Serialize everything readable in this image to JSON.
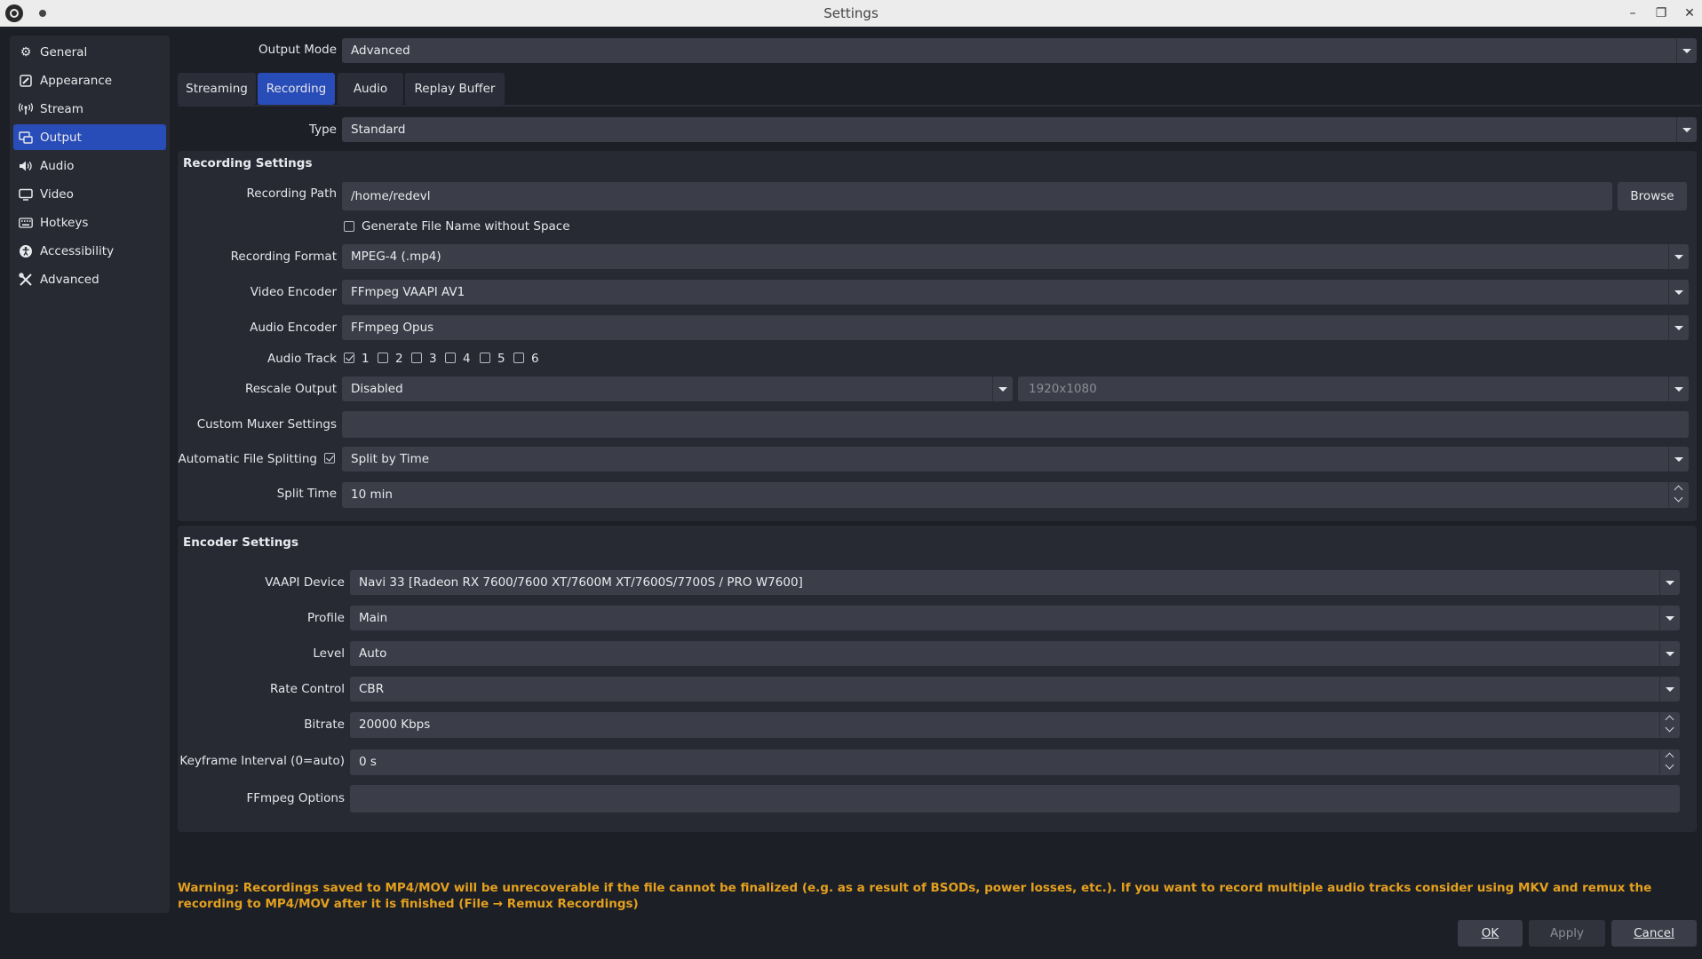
{
  "window": {
    "title": "Settings"
  },
  "sidebar": {
    "items": [
      {
        "label": "General",
        "icon": "gear-icon"
      },
      {
        "label": "Appearance",
        "icon": "appearance-icon"
      },
      {
        "label": "Stream",
        "icon": "antenna-icon"
      },
      {
        "label": "Output",
        "icon": "output-icon",
        "active": true
      },
      {
        "label": "Audio",
        "icon": "speaker-icon"
      },
      {
        "label": "Video",
        "icon": "monitor-icon"
      },
      {
        "label": "Hotkeys",
        "icon": "keyboard-icon"
      },
      {
        "label": "Accessibility",
        "icon": "accessibility-icon"
      },
      {
        "label": "Advanced",
        "icon": "tools-icon"
      }
    ]
  },
  "output_mode": {
    "label": "Output Mode",
    "value": "Advanced"
  },
  "tabs": [
    {
      "label": "Streaming"
    },
    {
      "label": "Recording",
      "active": true
    },
    {
      "label": "Audio"
    },
    {
      "label": "Replay Buffer"
    }
  ],
  "type": {
    "label": "Type",
    "value": "Standard"
  },
  "recording_settings": {
    "title": "Recording Settings",
    "path_label": "Recording Path",
    "path_value": "/home/redevl",
    "browse_label": "Browse",
    "gen_filename_label": "Generate File Name without Space",
    "gen_filename_checked": false,
    "format_label": "Recording Format",
    "format_value": "MPEG-4 (.mp4)",
    "video_encoder_label": "Video Encoder",
    "video_encoder_value": "FFmpeg VAAPI AV1",
    "audio_encoder_label": "Audio Encoder",
    "audio_encoder_value": "FFmpeg Opus",
    "audio_track_label": "Audio Track",
    "audio_tracks": [
      {
        "label": "1",
        "checked": true
      },
      {
        "label": "2",
        "checked": false
      },
      {
        "label": "3",
        "checked": false
      },
      {
        "label": "4",
        "checked": false
      },
      {
        "label": "5",
        "checked": false
      },
      {
        "label": "6",
        "checked": false
      }
    ],
    "rescale_label": "Rescale Output",
    "rescale_value": "Disabled",
    "rescale_resolution": "1920x1080",
    "muxer_label": "Custom Muxer Settings",
    "muxer_value": "",
    "split_label": "Automatic File Splitting",
    "split_checked": true,
    "split_value": "Split by Time",
    "split_time_label": "Split Time",
    "split_time_value": "10 min"
  },
  "encoder_settings": {
    "title": "Encoder Settings",
    "device_label": "VAAPI Device",
    "device_value": "Navi 33 [Radeon RX 7600/7600 XT/7600M XT/7600S/7700S / PRO W7600]",
    "profile_label": "Profile",
    "profile_value": "Main",
    "level_label": "Level",
    "level_value": "Auto",
    "rate_control_label": "Rate Control",
    "rate_control_value": "CBR",
    "bitrate_label": "Bitrate",
    "bitrate_value": "20000 Kbps",
    "keyframe_label": "Keyframe Interval (0=auto)",
    "keyframe_value": "0 s",
    "ffmpeg_options_label": "FFmpeg Options",
    "ffmpeg_options_value": ""
  },
  "warning": "Warning: Recordings saved to MP4/MOV will be unrecoverable if the file cannot be finalized (e.g. as a result of BSODs, power losses, etc.). If you want to record multiple audio tracks consider using MKV and remux the recording to MP4/MOV after it is finished (File → Remux Recordings)",
  "footer": {
    "ok_label": "OK",
    "apply_label": "Apply",
    "cancel_label": "Cancel"
  },
  "colors": {
    "accent": "#284cb8",
    "warning": "#e3a01e",
    "background": "#1d1f26"
  }
}
